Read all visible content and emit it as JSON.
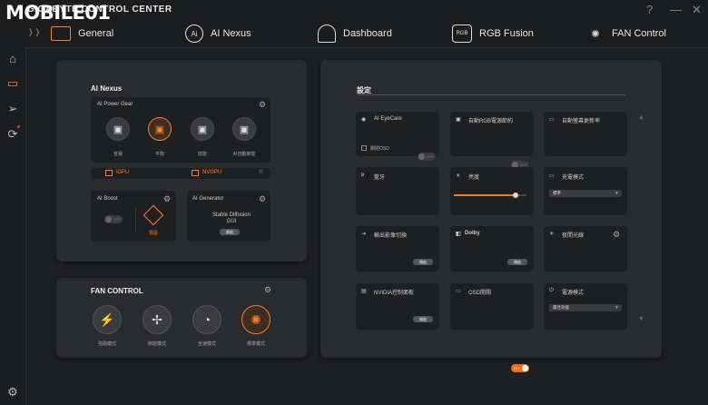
{
  "app": {
    "title": "GIGABYTE CONTROL CENTER",
    "watermark": "MOBILE01",
    "help_icon": "?",
    "minimize_icon": "—",
    "close_icon": "✕"
  },
  "tabs": [
    {
      "label": "General",
      "icon": "laptop-icon",
      "active": true
    },
    {
      "label": "AI Nexus",
      "icon": "ai-icon",
      "active": false
    },
    {
      "label": "Dashboard",
      "icon": "gauge-icon",
      "active": false
    },
    {
      "label": "RGB Fusion",
      "icon": "rgb-icon",
      "active": false
    },
    {
      "label": "FAN Control",
      "icon": "fan-icon",
      "active": false
    }
  ],
  "tab_icon_glyphs": {
    "ai": "Ai",
    "rgb": "RGB"
  },
  "sidebar": {
    "items": [
      "home-icon",
      "monitor-icon",
      "send-icon",
      "sync-icon"
    ],
    "bottom": "settings-icon"
  },
  "ai_nexus": {
    "title": "AI Nexus",
    "power_gear": {
      "title": "AI Power Gear",
      "modes": [
        {
          "label": "省電",
          "active": false
        },
        {
          "label": "平衡",
          "active": true
        },
        {
          "label": "效能",
          "active": false
        },
        {
          "label": "AI自動節能",
          "active": false
        }
      ],
      "gpu_options": [
        "iGPU",
        "NVGPU"
      ]
    },
    "ai_boost": {
      "title": "AI Boost",
      "toggle": "OFF",
      "mode_label": "預設"
    },
    "ai_generator": {
      "title": "AI Generator",
      "line1": "Stable Diffusion",
      "line2": "GUI",
      "button": "開啟"
    }
  },
  "fan_control": {
    "title": "FAN CONTROL",
    "modes": [
      {
        "label": "強勁模式",
        "active": false
      },
      {
        "label": "節能模式",
        "active": false
      },
      {
        "label": "全速模式",
        "active": false
      },
      {
        "label": "標準模式",
        "active": true
      }
    ]
  },
  "settings": {
    "title": "設定",
    "tiles": {
      "ai_eyecare": {
        "label": "AI EyeCare",
        "sub": "關閉OSD",
        "toggle": "OFF"
      },
      "rgb_power": {
        "label": "自動RGB電源節約",
        "toggle": "OFF"
      },
      "refresh": {
        "label": "自動螢幕更新率",
        "toggle": "ON"
      },
      "bluetooth": {
        "label": "藍牙",
        "toggle": "ON"
      },
      "brightness": {
        "label": "亮度",
        "value": 0.85
      },
      "charge": {
        "label": "充電模式",
        "select": "標準"
      },
      "output": {
        "label": "輸出影像切換",
        "button": "開啟"
      },
      "dolby": {
        "label": "Dolby",
        "button": "開啟"
      },
      "nightlight": {
        "label": "夜間光線",
        "toggle": "OFF"
      },
      "nvidia": {
        "label": "NVIDIA控制面板",
        "button": "開啟"
      },
      "osd": {
        "label": "OSD開關",
        "toggle": "ON"
      },
      "power": {
        "label": "電源模式",
        "select": "最佳效能"
      }
    }
  },
  "colors": {
    "accent": "#ff7a1a",
    "panel": "#2a2b2e",
    "card": "#1e1f21"
  }
}
